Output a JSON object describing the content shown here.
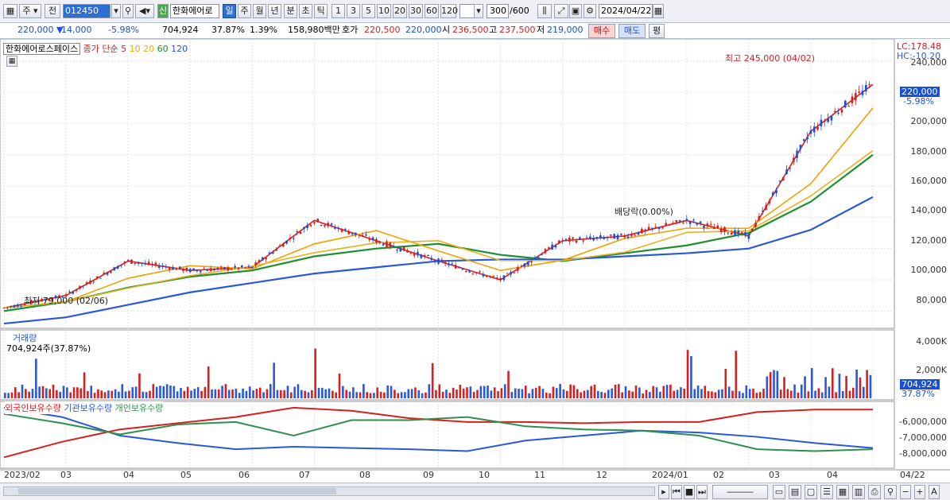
{
  "toolbar": {
    "market_btn": "주",
    "prev_btn": "전",
    "code": "012450",
    "new_badge": "신",
    "stock_name": "한화에어로",
    "period_tabs": [
      "일",
      "주",
      "월",
      "년",
      "분",
      "초",
      "틱"
    ],
    "interval_tabs": [
      "1",
      "3",
      "5",
      "10",
      "20",
      "30",
      "60",
      "120"
    ],
    "count": "300",
    "count_total": "/600",
    "date": "2024/04/22"
  },
  "quote": {
    "price": "220,000",
    "change": "14,000",
    "change_pct": "-5.98%",
    "volume": "704,924",
    "turnover_pct": "37.87%",
    "vol_change": "1.39%",
    "amount": "158,980백만",
    "bid_label": "호가",
    "ask": "220,500",
    "bid": "220,000",
    "open_label": "시",
    "open": "236,500",
    "high_label": "고",
    "high": "237,500",
    "low_label": "저",
    "low": "219,000",
    "buy_btn": "매수",
    "sell_btn": "매도",
    "eval_btn": "평"
  },
  "price_pane": {
    "title": "한화에어로스페이스",
    "ma_label": "종가 단순",
    "ma_periods": [
      "5",
      "10",
      "20",
      "60",
      "120"
    ],
    "ma_colors": [
      "#d61f1f",
      "#f0a000",
      "#e8b020",
      "#1e8f2e",
      "#2a58d8"
    ],
    "lc": "LC:178.48",
    "hc": "HC:-10.20",
    "high_note": "최고 245,000 (04/02)",
    "low_note": "최저 79,000 (02/06)",
    "dividend_note": "배당락(0.00%)",
    "last_price": "220,000",
    "last_pct": "-5.98%",
    "yticks": [
      "240,000",
      "220,000",
      "200,000",
      "180,000",
      "160,000",
      "140,000",
      "120,000",
      "100,000",
      "80,000"
    ]
  },
  "volume_pane": {
    "title": "거래량",
    "value": "704,924주(37.87%)",
    "yticks": [
      "4,000K",
      "2,000K"
    ],
    "last": "704,924",
    "last_pct": "37.87%"
  },
  "holding_pane": {
    "legend": [
      "외국인보유수량",
      "기관보유수량",
      "개인보유수량"
    ],
    "colors": [
      "#d61f1f",
      "#2a58d8",
      "#2e8f4e"
    ],
    "yticks": [
      "-6,000,000",
      "-7,000,000",
      "-8,000,000"
    ]
  },
  "xaxis": [
    "2023/02",
    "03",
    "04",
    "05",
    "06",
    "07",
    "08",
    "09",
    "10",
    "11",
    "12",
    "2024/01",
    "02",
    "03",
    "04"
  ],
  "xaxis_end": "04/22",
  "chart_data": {
    "type": "line",
    "title": "한화에어로스페이스",
    "x": [
      "2023/02",
      "03",
      "04",
      "05",
      "06",
      "07",
      "08",
      "09",
      "10",
      "11",
      "12",
      "2024/01",
      "02",
      "03",
      "04"
    ],
    "series": [
      {
        "name": "5",
        "values": [
          82000,
          90000,
          112000,
          106000,
          108000,
          138000,
          125000,
          112000,
          100000,
          125000,
          128000,
          138000,
          128000,
          195000,
          225000
        ]
      },
      {
        "name": "60",
        "values": [
          80000,
          86000,
          95000,
          102000,
          106000,
          115000,
          120000,
          123000,
          116000,
          112000,
          117000,
          122000,
          130000,
          150000,
          180000
        ]
      },
      {
        "name": "120",
        "values": [
          72000,
          76000,
          84000,
          92000,
          98000,
          104000,
          108000,
          112000,
          113000,
          113000,
          115000,
          117000,
          120000,
          132000,
          153000
        ]
      }
    ],
    "ylim": [
      70000,
      248000
    ],
    "high": 245000,
    "low": 79000
  }
}
